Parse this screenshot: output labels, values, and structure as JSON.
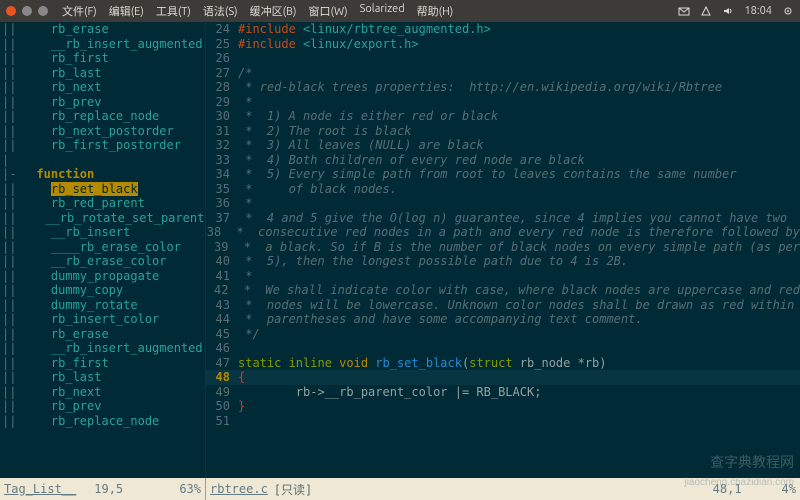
{
  "topbar": {
    "menus": [
      "文件(F)",
      "编辑(E)",
      "工具(T)",
      "语法(S)",
      "缓冲区(B)",
      "窗口(W)",
      "Solarized",
      "帮助(H)"
    ],
    "time": "18:04"
  },
  "sidebar": {
    "items": [
      {
        "fold": "||",
        "indent": "    ",
        "label": "rb_erase"
      },
      {
        "fold": "||",
        "indent": "    ",
        "label": "__rb_insert_augmented"
      },
      {
        "fold": "||",
        "indent": "    ",
        "label": "rb_first"
      },
      {
        "fold": "||",
        "indent": "    ",
        "label": "rb_last"
      },
      {
        "fold": "||",
        "indent": "    ",
        "label": "rb_next"
      },
      {
        "fold": "||",
        "indent": "    ",
        "label": "rb_prev"
      },
      {
        "fold": "||",
        "indent": "    ",
        "label": "rb_replace_node"
      },
      {
        "fold": "||",
        "indent": "    ",
        "label": "rb_next_postorder"
      },
      {
        "fold": "||",
        "indent": "    ",
        "label": "rb_first_postorder"
      },
      {
        "fold": "|",
        "indent": "",
        "label": ""
      },
      {
        "fold": "|-",
        "indent": "  ",
        "label": "function",
        "heading": true
      },
      {
        "fold": "||",
        "indent": "    ",
        "label": "rb_set_black",
        "selected": true
      },
      {
        "fold": "||",
        "indent": "    ",
        "label": "rb_red_parent"
      },
      {
        "fold": "||",
        "indent": "    ",
        "label": "__rb_rotate_set_parents"
      },
      {
        "fold": "||",
        "indent": "    ",
        "label": "__rb_insert"
      },
      {
        "fold": "||",
        "indent": "    ",
        "label": "____rb_erase_color"
      },
      {
        "fold": "||",
        "indent": "    ",
        "label": "__rb_erase_color"
      },
      {
        "fold": "||",
        "indent": "    ",
        "label": "dummy_propagate"
      },
      {
        "fold": "||",
        "indent": "    ",
        "label": "dummy_copy"
      },
      {
        "fold": "||",
        "indent": "    ",
        "label": "dummy_rotate"
      },
      {
        "fold": "||",
        "indent": "    ",
        "label": "rb_insert_color"
      },
      {
        "fold": "||",
        "indent": "    ",
        "label": "rb_erase"
      },
      {
        "fold": "||",
        "indent": "    ",
        "label": "__rb_insert_augmented"
      },
      {
        "fold": "||",
        "indent": "    ",
        "label": "rb_first"
      },
      {
        "fold": "||",
        "indent": "    ",
        "label": "rb_last"
      },
      {
        "fold": "||",
        "indent": "    ",
        "label": "rb_next"
      },
      {
        "fold": "||",
        "indent": "    ",
        "label": "rb_prev"
      },
      {
        "fold": "||",
        "indent": "    ",
        "label": "rb_replace_node"
      }
    ]
  },
  "code": {
    "lines": [
      {
        "n": "24",
        "tokens": [
          {
            "c": "c-pp",
            "t": "#include "
          },
          {
            "c": "c-str",
            "t": "<linux/rbtree_augmented.h>"
          }
        ]
      },
      {
        "n": "25",
        "tokens": [
          {
            "c": "c-pp",
            "t": "#include "
          },
          {
            "c": "c-str",
            "t": "<linux/export.h>"
          }
        ]
      },
      {
        "n": "26",
        "tokens": []
      },
      {
        "n": "27",
        "tokens": [
          {
            "c": "c-cmt",
            "t": "/*"
          }
        ]
      },
      {
        "n": "28",
        "tokens": [
          {
            "c": "c-cmt",
            "t": " * red-black trees properties:  http://en.wikipedia.org/wiki/Rbtree"
          }
        ]
      },
      {
        "n": "29",
        "tokens": [
          {
            "c": "c-cmt",
            "t": " *"
          }
        ]
      },
      {
        "n": "30",
        "tokens": [
          {
            "c": "c-cmt",
            "t": " *  1) A node is either red or black"
          }
        ]
      },
      {
        "n": "31",
        "tokens": [
          {
            "c": "c-cmt",
            "t": " *  2) The root is black"
          }
        ]
      },
      {
        "n": "32",
        "tokens": [
          {
            "c": "c-cmt",
            "t": " *  3) All leaves (NULL) are black"
          }
        ]
      },
      {
        "n": "33",
        "tokens": [
          {
            "c": "c-cmt",
            "t": " *  4) Both children of every red node are black"
          }
        ]
      },
      {
        "n": "34",
        "tokens": [
          {
            "c": "c-cmt",
            "t": " *  5) Every simple path from root to leaves contains the same number"
          }
        ]
      },
      {
        "n": "35",
        "tokens": [
          {
            "c": "c-cmt",
            "t": " *     of black nodes."
          }
        ]
      },
      {
        "n": "36",
        "tokens": [
          {
            "c": "c-cmt",
            "t": " *"
          }
        ]
      },
      {
        "n": "37",
        "tokens": [
          {
            "c": "c-cmt",
            "t": " *  4 and 5 give the O(log n) guarantee, since 4 implies you cannot have two"
          }
        ]
      },
      {
        "n": "38",
        "tokens": [
          {
            "c": "c-cmt",
            "t": " *  consecutive red nodes in a path and every red node is therefore followed by"
          }
        ]
      },
      {
        "n": "39",
        "tokens": [
          {
            "c": "c-cmt",
            "t": " *  a black. So if B is the number of black nodes on every simple path (as per"
          }
        ]
      },
      {
        "n": "40",
        "tokens": [
          {
            "c": "c-cmt",
            "t": " *  5), then the longest possible path due to 4 is 2B."
          }
        ]
      },
      {
        "n": "41",
        "tokens": [
          {
            "c": "c-cmt",
            "t": " *"
          }
        ]
      },
      {
        "n": "42",
        "tokens": [
          {
            "c": "c-cmt",
            "t": " *  We shall indicate color with case, where black nodes are uppercase and red"
          }
        ]
      },
      {
        "n": "43",
        "tokens": [
          {
            "c": "c-cmt",
            "t": " *  nodes will be lowercase. Unknown color nodes shall be drawn as red within"
          }
        ]
      },
      {
        "n": "44",
        "tokens": [
          {
            "c": "c-cmt",
            "t": " *  parentheses and have some accompanying text comment."
          }
        ]
      },
      {
        "n": "45",
        "tokens": [
          {
            "c": "c-cmt",
            "t": " */"
          }
        ]
      },
      {
        "n": "46",
        "tokens": []
      },
      {
        "n": "47",
        "tokens": [
          {
            "c": "c-kw",
            "t": "static inline "
          },
          {
            "c": "c-type",
            "t": "void "
          },
          {
            "c": "c-fn",
            "t": "rb_set_black"
          },
          {
            "c": "c-txt",
            "t": "("
          },
          {
            "c": "c-kw",
            "t": "struct "
          },
          {
            "c": "c-txt",
            "t": "rb_node *rb)"
          }
        ]
      },
      {
        "n": "48",
        "tokens": [
          {
            "c": "c-brace",
            "t": "{"
          }
        ],
        "current": true
      },
      {
        "n": "49",
        "tokens": [
          {
            "c": "c-txt",
            "t": "        rb->__rb_parent_color |= RB_BLACK;"
          }
        ]
      },
      {
        "n": "50",
        "tokens": [
          {
            "c": "c-brace",
            "t": "}"
          }
        ]
      },
      {
        "n": "51",
        "tokens": []
      }
    ]
  },
  "status": {
    "left_name": "Tag_List__",
    "left_pos": "19,5",
    "left_pct": "63%",
    "right_name": "rbtree.c",
    "right_flag": "[只读]",
    "right_pos": "48,1",
    "right_pct": "4%"
  },
  "watermark": {
    "big": "查字典教程网",
    "small": "jiaocheng.chazidian.com"
  }
}
